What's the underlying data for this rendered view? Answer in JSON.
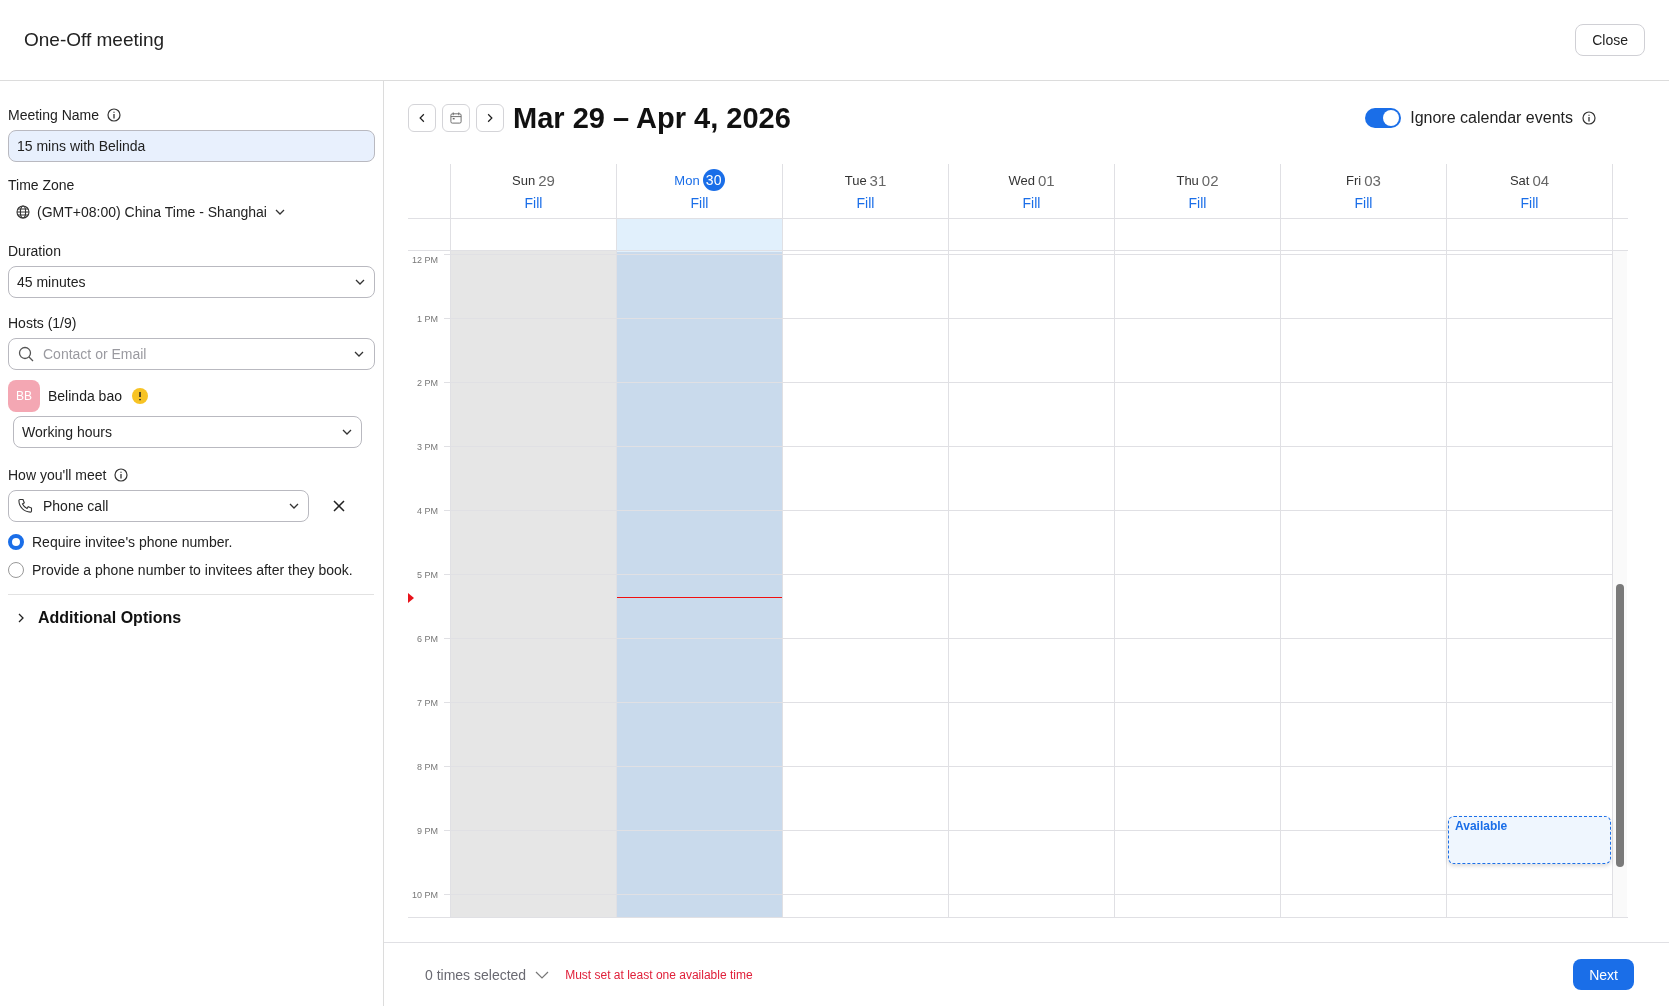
{
  "window": {
    "title": "One-Off meeting",
    "close_button": "Close"
  },
  "form": {
    "meeting_name": {
      "label": "Meeting Name",
      "value": "15 mins with Belinda"
    },
    "time_zone": {
      "label": "Time Zone",
      "value": "(GMT+08:00) China Time - Shanghai"
    },
    "duration": {
      "label": "Duration",
      "value": "45 minutes"
    },
    "hosts": {
      "label": "Hosts (1/9)",
      "placeholder": "Contact or Email",
      "items": [
        {
          "initials": "BB",
          "name": "Belinda bao",
          "warning": true,
          "availability": "Working hours"
        }
      ]
    },
    "meet": {
      "label": "How you'll meet",
      "value": "Phone call",
      "options": [
        {
          "label": "Require invitee's phone number.",
          "selected": true
        },
        {
          "label": "Provide a phone number to invitees after they book.",
          "selected": false
        }
      ]
    },
    "additional": {
      "label": "Additional Options",
      "expanded": false
    }
  },
  "calendar": {
    "range": "Mar 29 – Apr 4, 2026",
    "toggle": {
      "label": "Ignore calendar events",
      "on": true
    },
    "days": [
      {
        "name": "Sun",
        "date": "29",
        "fill": "Fill",
        "today": false,
        "past": true
      },
      {
        "name": "Mon",
        "date": "30",
        "fill": "Fill",
        "today": true,
        "past": false
      },
      {
        "name": "Tue",
        "date": "31",
        "fill": "Fill",
        "today": false,
        "past": false
      },
      {
        "name": "Wed",
        "date": "01",
        "fill": "Fill",
        "today": false,
        "past": false
      },
      {
        "name": "Thu",
        "date": "02",
        "fill": "Fill",
        "today": false,
        "past": false
      },
      {
        "name": "Fri",
        "date": "03",
        "fill": "Fill",
        "today": false,
        "past": false
      },
      {
        "name": "Sat",
        "date": "04",
        "fill": "Fill",
        "today": false,
        "past": false,
        "events": [
          {
            "label": "Available"
          }
        ]
      }
    ],
    "hours": [
      "12 PM",
      "1 PM",
      "2 PM",
      "3 PM",
      "4 PM",
      "5 PM",
      "6 PM",
      "7 PM",
      "8 PM",
      "9 PM",
      "10 PM"
    ]
  },
  "footer": {
    "selected": "0 times selected",
    "error": "Must set at least one available time",
    "next_button": "Next"
  }
}
